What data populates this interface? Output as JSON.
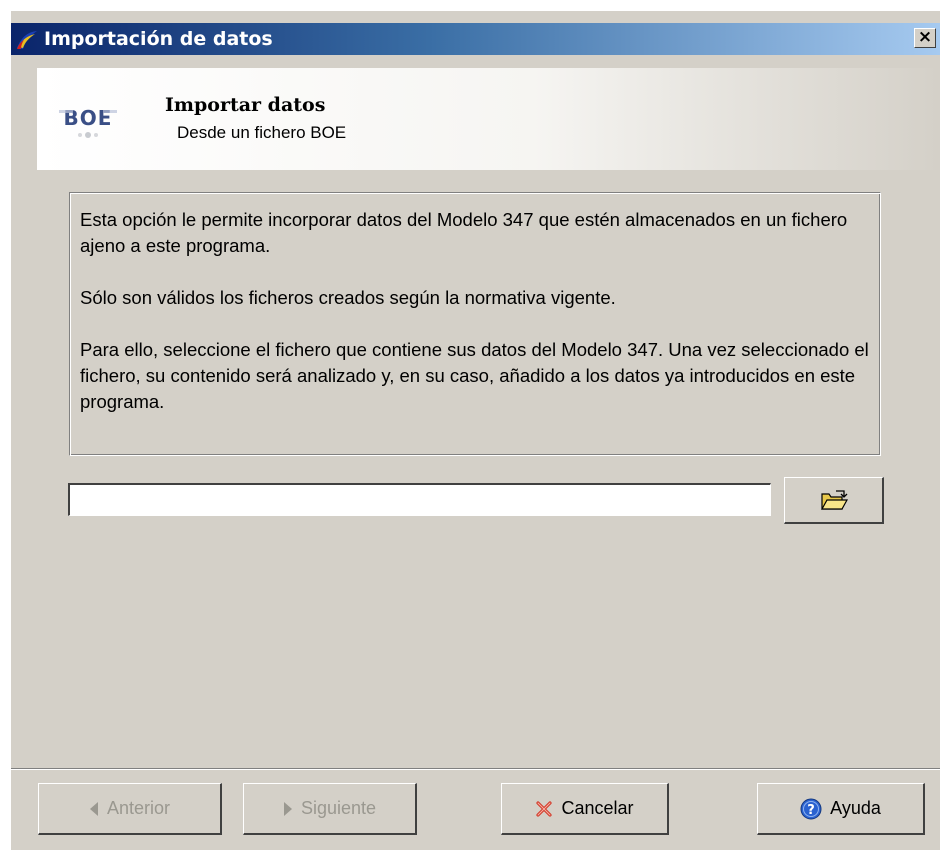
{
  "window": {
    "title": "Importación de datos",
    "close_glyph": "×"
  },
  "header": {
    "title": "Importar datos",
    "subtitle": "Desde un fichero BOE",
    "logo_text": "BOE"
  },
  "info": {
    "paragraphs": [
      "Esta opción le permite incorporar datos del Modelo 347 que estén almacenados en un fichero ajeno a este programa.",
      "Sólo son válidos los ficheros creados según la normativa vigente.",
      "Para ello, seleccione el fichero que contiene sus datos del Modelo 347. Una vez seleccionado el fichero, su contenido será analizado y, en su caso, añadido a los datos ya introducidos en este programa."
    ]
  },
  "file_picker": {
    "value": "",
    "browse_icon": "open-folder-icon"
  },
  "buttons": {
    "previous": {
      "label": "Anterior",
      "icon": "arrow-left-icon",
      "enabled": false
    },
    "next": {
      "label": "Siguiente",
      "icon": "arrow-right-icon",
      "enabled": false
    },
    "cancel": {
      "label": "Cancelar",
      "icon": "red-x-icon",
      "enabled": true
    },
    "help": {
      "label": "Ayuda",
      "icon": "help-icon",
      "enabled": true
    }
  },
  "colors": {
    "title_gradient_start": "#0a246a",
    "title_gradient_end": "#a6caf0",
    "window_face": "#d4d0c8",
    "disabled_text": "#9a9890",
    "cancel_icon_red": "#d23a2a",
    "help_icon_blue": "#2a62d0"
  }
}
